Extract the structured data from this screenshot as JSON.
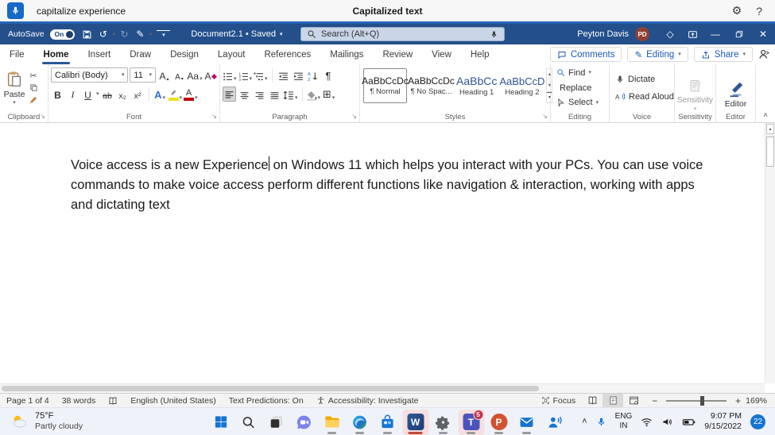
{
  "voice_bar": {
    "command": "capitalize experience",
    "status": "Capitalized text"
  },
  "title_bar": {
    "autosave_label": "AutoSave",
    "autosave_state": "On",
    "document_title": "Document2.1 • Saved",
    "search_placeholder": "Search (Alt+Q)",
    "user_name": "Peyton Davis",
    "user_initials": "PD"
  },
  "ribbon": {
    "tabs": [
      "File",
      "Home",
      "Insert",
      "Draw",
      "Design",
      "Layout",
      "References",
      "Mailings",
      "Review",
      "View",
      "Help"
    ],
    "active_tab": "Home",
    "collab": {
      "comments": "Comments",
      "editing": "Editing",
      "share": "Share"
    },
    "clipboard": {
      "paste": "Paste",
      "label": "Clipboard"
    },
    "font": {
      "name": "Calibri (Body)",
      "size": "11",
      "label": "Font",
      "bold": "B",
      "italic": "I",
      "underline": "U",
      "strikethrough": "ab",
      "subscript": "x₂",
      "superscript": "x²",
      "effects": "A",
      "change_case": "Aa",
      "grow": "A",
      "shrink": "A",
      "clear": "A",
      "font_color": "A"
    },
    "paragraph": {
      "label": "Paragraph"
    },
    "styles": {
      "label": "Styles",
      "items": [
        {
          "preview": "AaBbCcDc",
          "name": "¶ Normal"
        },
        {
          "preview": "AaBbCcDc",
          "name": "¶ No Spac..."
        },
        {
          "preview": "AaBbCc",
          "name": "Heading 1"
        },
        {
          "preview": "AaBbCcD",
          "name": "Heading 2"
        }
      ]
    },
    "editing": {
      "find": "Find",
      "replace": "Replace",
      "select": "Select",
      "label": "Editing"
    },
    "voice": {
      "dictate": "Dictate",
      "read_aloud": "Read Aloud",
      "label": "Voice"
    },
    "sensitivity": {
      "button": "Sensitivity",
      "label": "Sensitivity"
    },
    "editor": {
      "button": "Editor",
      "label": "Editor"
    }
  },
  "document": {
    "text_before_cursor": "Voice access is a new Experience",
    "text_after_cursor": " on Windows 11 which helps you interact with your PCs. You can use voice commands to make voice access perform different functions like navigation & interaction, working with apps and dictating text"
  },
  "status_bar": {
    "page_info": "Page 1 of 4",
    "word_count": "38 words",
    "language": "English (United States)",
    "text_predictions": "Text Predictions: On",
    "accessibility": "Accessibility: Investigate",
    "focus_label": "Focus",
    "zoom_level": "169%"
  },
  "taskbar": {
    "weather_temp": "75°F",
    "weather_desc": "Partly cloudy",
    "lang_line1": "ENG",
    "lang_line2": "IN",
    "time": "9:07 PM",
    "date": "9/15/2022",
    "notification_count": "22",
    "teams_badge": "5",
    "word_letter": "W",
    "teams_letter": "T",
    "ppt_letter": "P"
  },
  "icons": {
    "chevron_down": "▾",
    "chevron_up": "▴",
    "pilcrow": "¶",
    "scissors": "✂",
    "gear": "⚙",
    "help": "?",
    "undo": "↺",
    "redo": "↻",
    "pencil": "✎",
    "diamond": "◇",
    "minimize": "—",
    "close": "✕",
    "collapse": "˄",
    "hidden_icons": "˄",
    "borders_grid": "⊞",
    "launcher": "↘",
    "dots": "•"
  },
  "colors": {
    "title_bar_blue": "#234f8b",
    "accent_blue": "#185abd",
    "heading_blue": "#2f5496",
    "voice_mic_blue": "#1569c8",
    "word_blue": "#2b579a",
    "badge_blue": "#1774d1",
    "teams_badge_red": "#c4314b",
    "active_app_red": "#c74634",
    "highlight_yellow": "#f0e020",
    "font_color_red": "#c00000"
  }
}
